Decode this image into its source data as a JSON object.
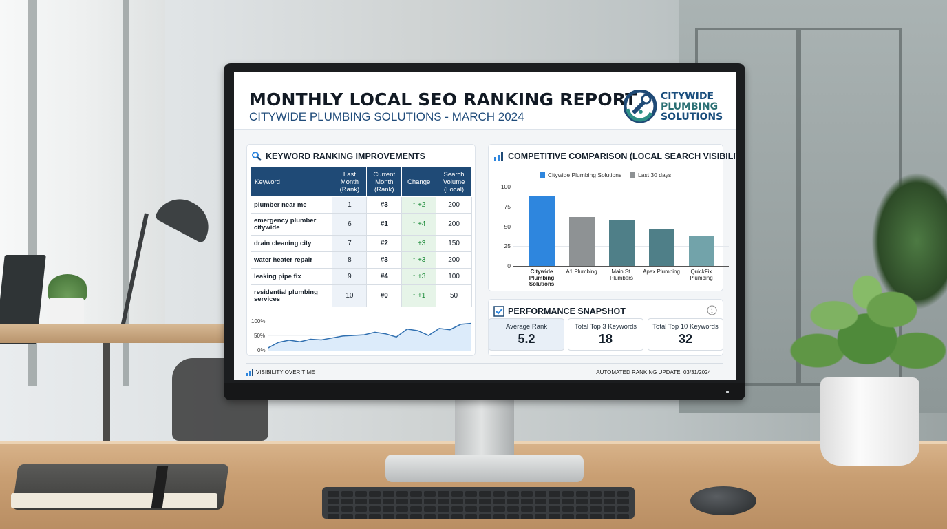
{
  "report": {
    "title": "MONTHLY LOCAL SEO RANKING REPORT",
    "subtitle": "CITYWIDE PLUMBING SOLUTIONS - MARCH 2024",
    "logo_lines": [
      "CITYWIDE",
      "PLUMBING",
      "SOLUTIONS"
    ]
  },
  "keyword_card": {
    "title": "KEYWORD RANKING IMPROVEMENTS",
    "columns": [
      "Keyword",
      "Last Month (Rank)",
      "Current Month (Rank)",
      "Change",
      "Search Volume (Local)"
    ],
    "rows": [
      {
        "keyword": "plumber near me",
        "last": "1",
        "current": "#3",
        "change": "+2",
        "volume": "200"
      },
      {
        "keyword": "emergency plumber citywide",
        "last": "6",
        "current": "#1",
        "change": "+4",
        "volume": "200"
      },
      {
        "keyword": "drain cleaning city",
        "last": "7",
        "current": "#2",
        "change": "+3",
        "volume": "150"
      },
      {
        "keyword": "water heater repair",
        "last": "8",
        "current": "#3",
        "change": "+3",
        "volume": "200"
      },
      {
        "keyword": "leaking pipe fix",
        "last": "9",
        "current": "#4",
        "change": "+3",
        "volume": "100"
      },
      {
        "keyword": "residential plumbing services",
        "last": "10",
        "current": "#0",
        "change": "+1",
        "volume": "50"
      }
    ],
    "sparkline": {
      "y_ticks": [
        "100%",
        "50%",
        "0%"
      ],
      "values": [
        10,
        28,
        35,
        30,
        38,
        36,
        42,
        48,
        50,
        52,
        60,
        55,
        45,
        70,
        65,
        50,
        72,
        68,
        85,
        88
      ]
    }
  },
  "competitive_card": {
    "title": "COMPETITIVE COMPARISON (LOCAL SEARCH VISIBILITY)",
    "legend": [
      "Citywide Plumbing Solutions",
      "Last 30 days"
    ]
  },
  "chart_data": {
    "type": "bar",
    "categories": [
      "Citywide Plumbing Solutions",
      "A1 Plumbing",
      "Main St. Plumbers",
      "Apex Plumbing",
      "QuickFix Plumbing"
    ],
    "values": [
      89,
      62,
      58,
      46,
      37
    ],
    "ylim": [
      0,
      100
    ],
    "y_ticks": [
      "100",
      "75",
      "50",
      "25",
      "0"
    ],
    "colors": [
      "#2e86de",
      "#8e9294",
      "#4f7f88",
      "#4f7f88",
      "#72a3aa"
    ],
    "grid": true,
    "legend_position": "top"
  },
  "performance_card": {
    "title": "PERFORMANCE SNAPSHOT",
    "metrics": [
      {
        "label": "Average Rank",
        "value": "5.2"
      },
      {
        "label": "Total Top 3 Keywords",
        "value": "18"
      },
      {
        "label": "Total Top 10 Keywords",
        "value": "32"
      }
    ]
  },
  "footer": {
    "left": "VISIBILITY OVER TIME",
    "right": "AUTOMATED RANKING UPDATE: 03/31/2024"
  },
  "colors": {
    "header_blue": "#1f4a76",
    "accent_blue": "#2e86de",
    "improvement_green": "#1e8c3a"
  }
}
